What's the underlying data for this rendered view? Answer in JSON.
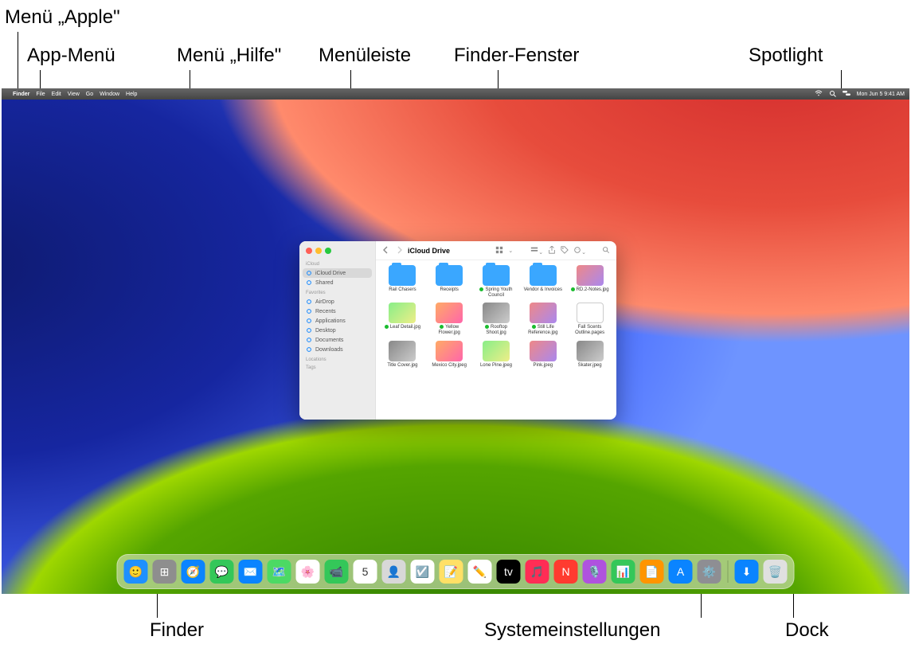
{
  "callouts": {
    "apple_menu": "Menü „Apple\"",
    "app_menu": "App-Menü",
    "help_menu": "Menü „Hilfe\"",
    "menubar": "Menüleiste",
    "finder_window": "Finder-Fenster",
    "spotlight": "Spotlight",
    "finder": "Finder",
    "system_settings": "Systemeinstellungen",
    "dock": "Dock"
  },
  "menubar": {
    "items": [
      "Finder",
      "File",
      "Edit",
      "View",
      "Go",
      "Window",
      "Help"
    ],
    "status": {
      "wifi": "wifi-icon",
      "spotlight": "search-icon",
      "control_center": "control-center-icon",
      "datetime": "Mon Jun 5  9:41 AM"
    }
  },
  "finder": {
    "title": "iCloud Drive",
    "sidebar": {
      "sections": [
        {
          "header": "iCloud",
          "items": [
            {
              "label": "iCloud Drive",
              "selected": true,
              "icon": "cloud"
            },
            {
              "label": "Shared",
              "selected": false,
              "icon": "folder-shared"
            }
          ]
        },
        {
          "header": "Favorites",
          "items": [
            {
              "label": "AirDrop",
              "icon": "airdrop"
            },
            {
              "label": "Recents",
              "icon": "clock"
            },
            {
              "label": "Applications",
              "icon": "apps"
            },
            {
              "label": "Desktop",
              "icon": "desktop"
            },
            {
              "label": "Documents",
              "icon": "doc"
            },
            {
              "label": "Downloads",
              "icon": "download"
            }
          ]
        },
        {
          "header": "Locations",
          "items": []
        },
        {
          "header": "Tags",
          "items": []
        }
      ]
    },
    "files": [
      {
        "name": "Rail Chasers",
        "type": "folder",
        "synced": false
      },
      {
        "name": "Receipts",
        "type": "folder",
        "synced": false
      },
      {
        "name": "Spring Youth Council",
        "type": "folder",
        "synced": true
      },
      {
        "name": "Vendor & Invoices",
        "type": "folder",
        "synced": false
      },
      {
        "name": "RD.2-Notes.jpg",
        "type": "img",
        "synced": true
      },
      {
        "name": "Leaf Detail.jpg",
        "type": "img2",
        "synced": true
      },
      {
        "name": "Yellow Flower.jpg",
        "type": "img3",
        "synced": true
      },
      {
        "name": "Rooftop Shoot.jpg",
        "type": "img4",
        "synced": true
      },
      {
        "name": "Still Life Reference.jpg",
        "type": "img",
        "synced": true
      },
      {
        "name": "Fall Scents Outline.pages",
        "type": "doc",
        "synced": false
      },
      {
        "name": "Title Cover.jpg",
        "type": "img4",
        "synced": false
      },
      {
        "name": "Mexico City.jpeg",
        "type": "img3",
        "synced": false
      },
      {
        "name": "Lone Pine.jpeg",
        "type": "img2",
        "synced": false
      },
      {
        "name": "Pink.jpeg",
        "type": "img",
        "synced": false
      },
      {
        "name": "Skater.jpeg",
        "type": "img4",
        "synced": false
      }
    ]
  },
  "dock": {
    "apps": [
      {
        "name": "finder",
        "color": "#1e90ff",
        "glyph": "🙂"
      },
      {
        "name": "launchpad",
        "color": "#8e8e8e",
        "glyph": "⊞"
      },
      {
        "name": "safari",
        "color": "#0a84ff",
        "glyph": "🧭"
      },
      {
        "name": "messages",
        "color": "#34c759",
        "glyph": "💬"
      },
      {
        "name": "mail",
        "color": "#0a84ff",
        "glyph": "✉️"
      },
      {
        "name": "maps",
        "color": "#4cd964",
        "glyph": "🗺️"
      },
      {
        "name": "photos",
        "color": "#ffffff",
        "glyph": "🌸"
      },
      {
        "name": "facetime",
        "color": "#34c759",
        "glyph": "📹"
      },
      {
        "name": "calendar",
        "color": "#ffffff",
        "glyph": "5"
      },
      {
        "name": "contacts",
        "color": "#d8d8d8",
        "glyph": "👤"
      },
      {
        "name": "reminders",
        "color": "#ffffff",
        "glyph": "☑️"
      },
      {
        "name": "notes",
        "color": "#ffe066",
        "glyph": "📝"
      },
      {
        "name": "freeform",
        "color": "#ffffff",
        "glyph": "✏️"
      },
      {
        "name": "tv",
        "color": "#000",
        "glyph": "tv"
      },
      {
        "name": "music",
        "color": "#ff2d55",
        "glyph": "🎵"
      },
      {
        "name": "news",
        "color": "#ff3b30",
        "glyph": "N"
      },
      {
        "name": "podcasts",
        "color": "#af52de",
        "glyph": "🎙️"
      },
      {
        "name": "numbers",
        "color": "#34c759",
        "glyph": "📊"
      },
      {
        "name": "pages",
        "color": "#ff9500",
        "glyph": "📄"
      },
      {
        "name": "appstore",
        "color": "#0a84ff",
        "glyph": "A"
      },
      {
        "name": "system-settings",
        "color": "#8e8e93",
        "glyph": "⚙️"
      }
    ],
    "right": [
      {
        "name": "downloads",
        "color": "#0a84ff",
        "glyph": "⬇︎"
      },
      {
        "name": "trash",
        "color": "#e0e0e0",
        "glyph": "🗑️"
      }
    ]
  }
}
